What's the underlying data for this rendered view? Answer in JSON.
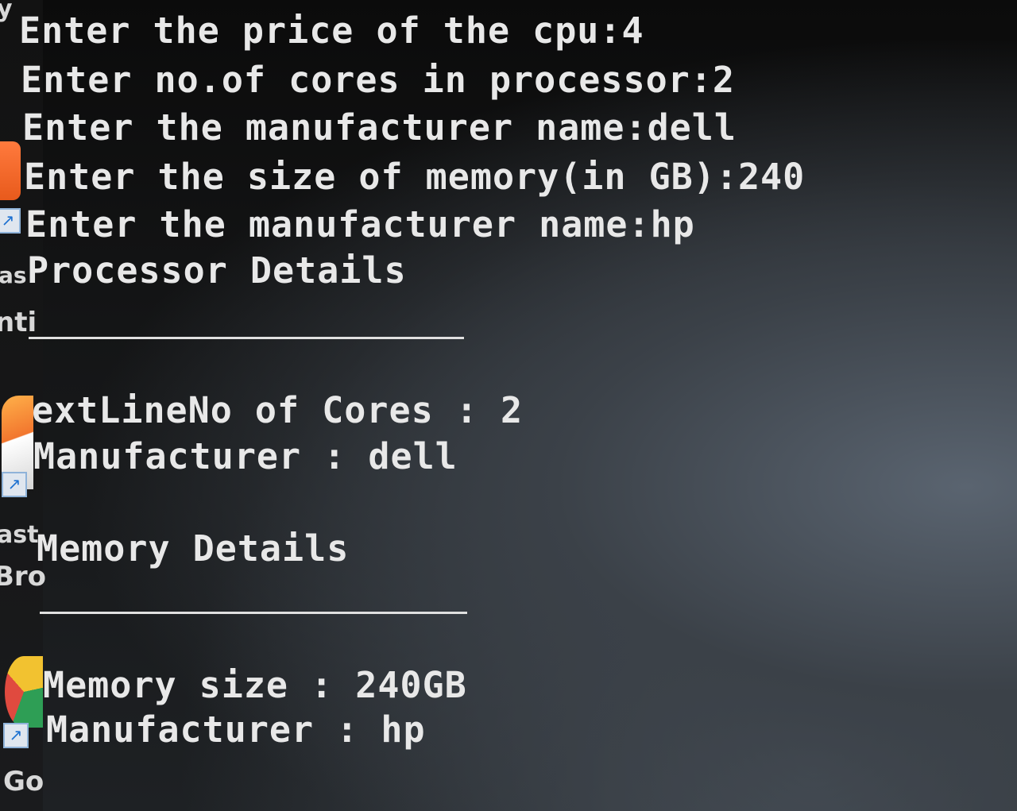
{
  "desktop": {
    "labels": [
      "y",
      "as",
      "nti",
      "ast",
      "Bro",
      "Go"
    ]
  },
  "console": {
    "lines": [
      "Enter the price of the cpu:4",
      "Enter no.of cores in processor:2",
      "Enter the manufacturer name:dell",
      "Enter the size of memory(in GB):240",
      "Enter the manufacturer name:hp",
      "Processor Details",
      "extLineNo of Cores : 2",
      "Manufacturer : dell",
      "Memory Details",
      "Memory size : 240GB",
      "Manufacturer : hp"
    ]
  },
  "colors": {
    "console_text": "#e8e8e8",
    "background": "#141516"
  }
}
